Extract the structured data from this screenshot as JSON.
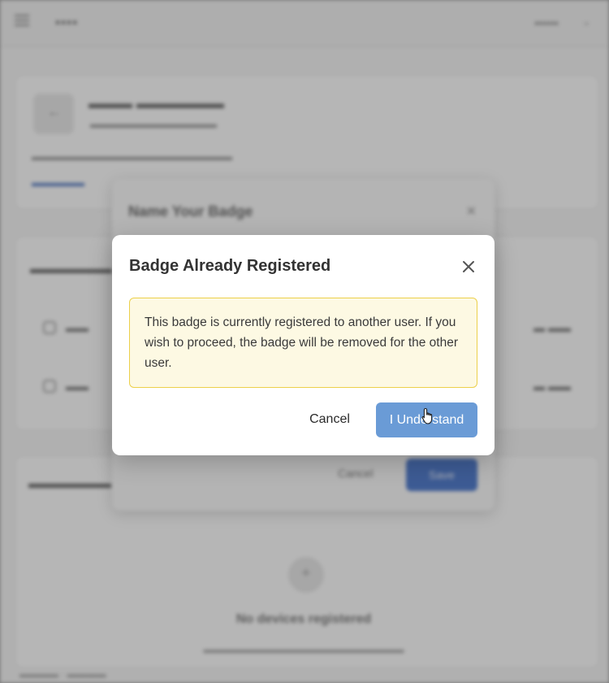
{
  "modal": {
    "title": "Badge Already Registered",
    "close_icon": "close-icon",
    "message": "This badge is currently registered to another user. If you wish to proceed, the badge will be removed for the other user.",
    "cancel_label": "Cancel",
    "confirm_label": "I Understand"
  },
  "colors": {
    "confirm_button": "#6a9bd6",
    "warning_background": "#fdf9e3",
    "warning_border": "#ecd04a"
  },
  "background": {
    "dialog_title": "Name Your Badge",
    "dialog_cancel": "Cancel",
    "dialog_save": "Save",
    "empty_title": "No devices registered"
  }
}
